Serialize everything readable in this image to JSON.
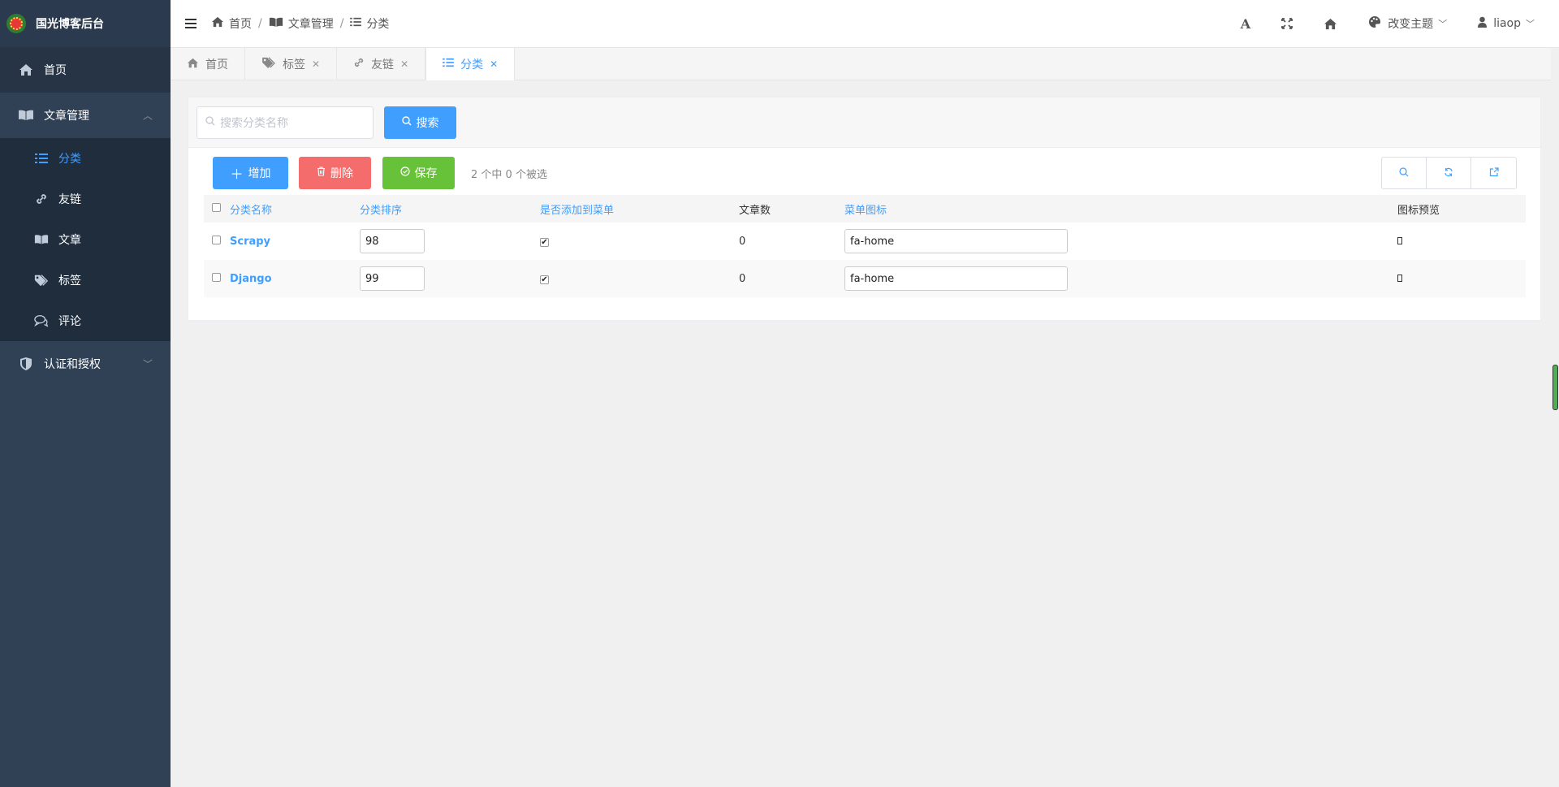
{
  "brand": {
    "title": "国光博客后台"
  },
  "sidebar": {
    "items": [
      {
        "label": "首页",
        "icon": "home-icon"
      },
      {
        "label": "文章管理",
        "icon": "book-icon",
        "expanded": true,
        "children": [
          {
            "label": "分类",
            "icon": "list-icon",
            "active": true
          },
          {
            "label": "友链",
            "icon": "link-icon"
          },
          {
            "label": "文章",
            "icon": "book-icon"
          },
          {
            "label": "标签",
            "icon": "tags-icon"
          },
          {
            "label": "评论",
            "icon": "comments-icon"
          }
        ]
      },
      {
        "label": "认证和授权",
        "icon": "shield-icon",
        "expanded": false
      }
    ]
  },
  "header": {
    "breadcrumb": [
      {
        "label": "首页",
        "icon": "home-icon"
      },
      {
        "label": "文章管理",
        "icon": "book-icon"
      },
      {
        "label": "分类",
        "icon": "list-icon"
      }
    ],
    "theme_label": "改变主题",
    "user_label": "liaop"
  },
  "tabs": [
    {
      "label": "首页",
      "icon": "home-icon",
      "closable": false
    },
    {
      "label": "标签",
      "icon": "tags-icon",
      "closable": true
    },
    {
      "label": "友链",
      "icon": "link-icon",
      "closable": true
    },
    {
      "label": "分类",
      "icon": "list-icon",
      "closable": true,
      "active": true
    }
  ],
  "search": {
    "placeholder": "搜索分类名称",
    "button_label": "搜索"
  },
  "toolbar": {
    "add_label": "增加",
    "delete_label": "删除",
    "save_label": "保存",
    "selection_info": "2 个中 0 个被选"
  },
  "table": {
    "columns": [
      "分类名称",
      "分类排序",
      "是否添加到菜单",
      "文章数",
      "菜单图标",
      "图标预览"
    ],
    "rows": [
      {
        "name": "Scrapy",
        "sort": "98",
        "in_menu": true,
        "article_count": "0",
        "menu_icon": "fa-home"
      },
      {
        "name": "Django",
        "sort": "99",
        "in_menu": true,
        "article_count": "0",
        "menu_icon": "fa-home"
      }
    ]
  },
  "colors": {
    "primary": "#409eff",
    "danger": "#f56c6c",
    "success": "#67c23a",
    "sidebar_bg": "#304156"
  }
}
